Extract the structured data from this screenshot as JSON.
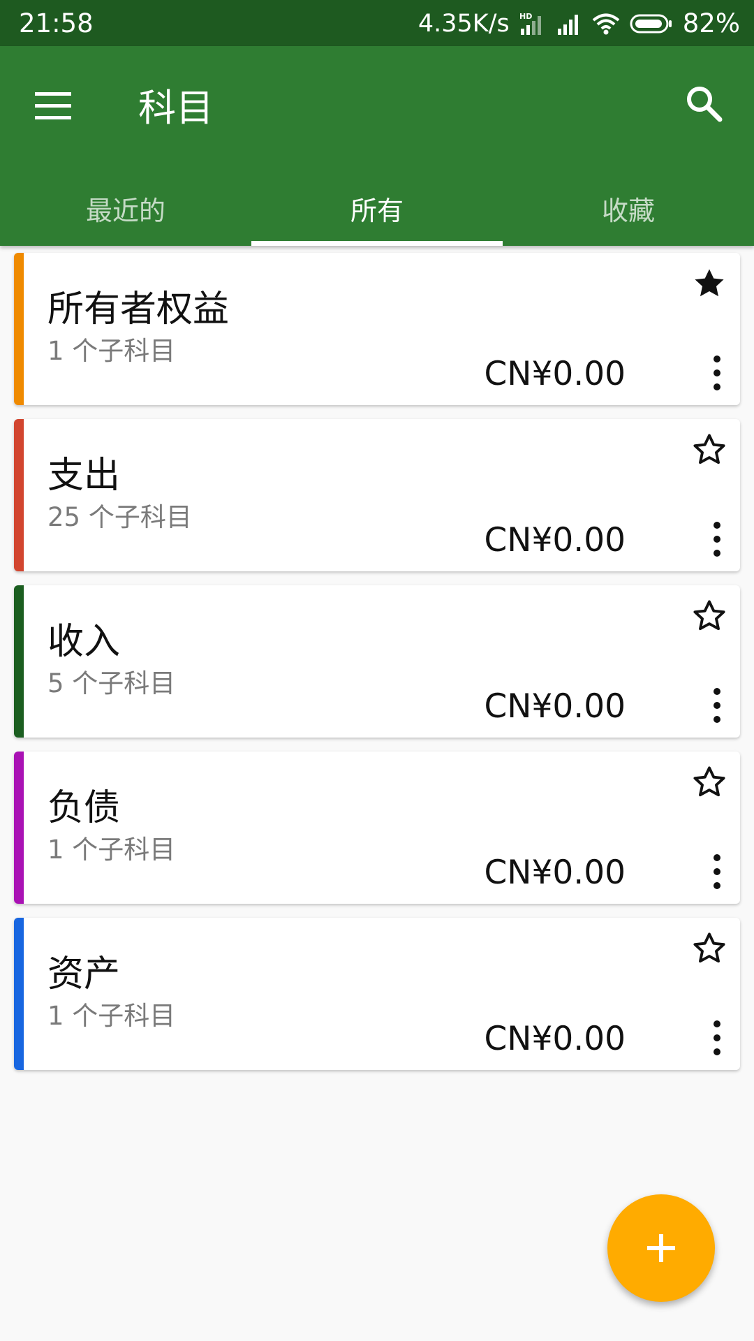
{
  "status_bar": {
    "time": "21:58",
    "net_speed": "4.35K/s",
    "hd_label": "HD",
    "battery_percent": "82%",
    "icons": [
      "hd-signal-icon",
      "cell-signal-icon",
      "wifi-icon",
      "battery-icon"
    ]
  },
  "app_bar": {
    "title": "科目",
    "menu_icon": "hamburger-menu-icon",
    "search_icon": "search-icon",
    "background_color": "#2f7d32"
  },
  "tabs": [
    {
      "label": "最近的",
      "active": false
    },
    {
      "label": "所有",
      "active": true
    },
    {
      "label": "收藏",
      "active": false
    }
  ],
  "accounts": [
    {
      "name": "所有者权益",
      "children": "1 个子科目",
      "balance": "CN¥0.00",
      "favorite": true,
      "color": "#ef8a00"
    },
    {
      "name": "支出",
      "children": "25 个子科目",
      "balance": "CN¥0.00",
      "favorite": false,
      "color": "#d2452f"
    },
    {
      "name": "收入",
      "children": "5 个子科目",
      "balance": "CN¥0.00",
      "favorite": false,
      "color": "#1b5e20"
    },
    {
      "name": "负债",
      "children": "1 个子科目",
      "balance": "CN¥0.00",
      "favorite": false,
      "color": "#a912b4"
    },
    {
      "name": "资产",
      "children": "1 个子科目",
      "balance": "CN¥0.00",
      "favorite": false,
      "color": "#1866e0"
    }
  ],
  "fab": {
    "icon": "plus-icon",
    "color": "#ffab00"
  }
}
